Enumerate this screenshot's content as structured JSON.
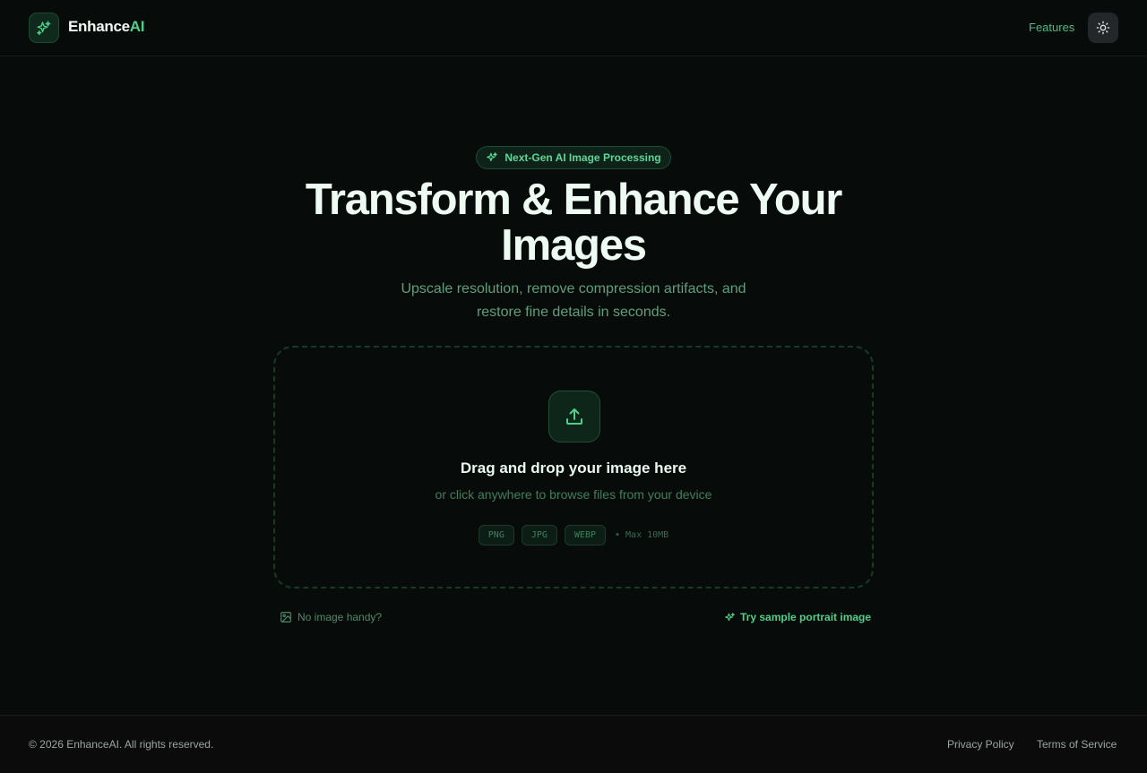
{
  "header": {
    "brand_main": "Enhance",
    "brand_accent": "AI",
    "nav_features": "Features",
    "logo_icon": "sparkles-icon",
    "theme_icon": "sun-icon"
  },
  "hero": {
    "badge": "Next-Gen AI Image Processing",
    "title_line1": "Transform & Enhance Your",
    "title_line2": "Images",
    "subtitle_line1": "Upscale resolution, remove compression artifacts, and",
    "subtitle_line2": "restore fine details in seconds."
  },
  "dropzone": {
    "title": "Drag and drop your image here",
    "subtitle": "or click anywhere to browse files from your device",
    "formats": [
      "PNG",
      "JPG",
      "WEBP"
    ],
    "max_size": "• Max 10MB",
    "upload_icon": "upload-icon"
  },
  "helpers": {
    "no_image": "No image handy?",
    "try_sample": "Try sample portrait image"
  },
  "footer": {
    "copyright": "© 2026 EnhanceAI. All rights reserved.",
    "privacy": "Privacy Policy",
    "terms": "Terms of Service"
  },
  "colors": {
    "accent": "#4fd08a",
    "background": "#070b09"
  }
}
